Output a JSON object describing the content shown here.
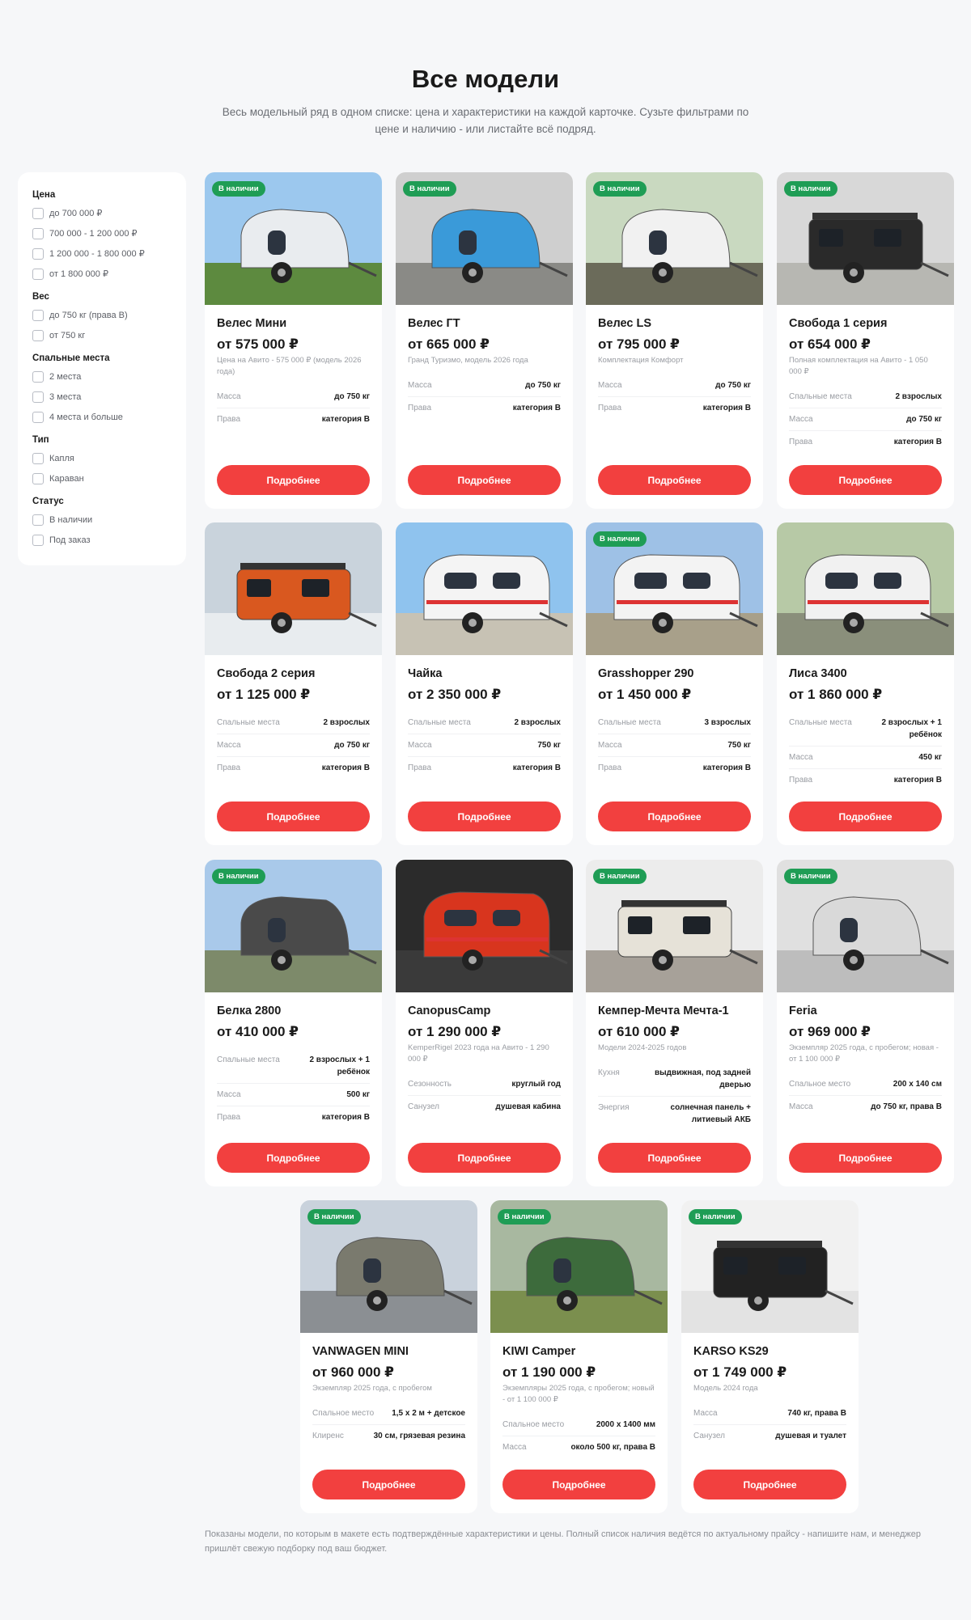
{
  "header": {
    "title": "Все модели",
    "subtitle": "Весь модельный ряд в одном списке: цена и характеристики на каждой карточке. Сузьте фильтрами по цене и наличию - или листайте всё подряд."
  },
  "filters": [
    {
      "title": "Цена",
      "options": [
        "до 700 000 ₽",
        "700 000 - 1 200 000 ₽",
        "1 200 000 - 1 800 000 ₽",
        "от 1 800 000 ₽"
      ]
    },
    {
      "title": "Вес",
      "options": [
        "до 750 кг (права B)",
        "от 750 кг"
      ]
    },
    {
      "title": "Спальные места",
      "options": [
        "2 места",
        "3 места",
        "4 места и больше"
      ]
    },
    {
      "title": "Тип",
      "options": [
        "Капля",
        "Караван"
      ]
    },
    {
      "title": "Статус",
      "options": [
        "В наличии",
        "Под заказ"
      ]
    }
  ],
  "badge_label": "В наличии",
  "button_label": "Подробнее",
  "cards": [
    {
      "title": "Велес Мини",
      "price": "от 575 000 ₽",
      "note": "Цена на Авито - 575 000 ₽ (модель 2026 года)",
      "badge": true,
      "specs": [
        [
          "Масса",
          "до 750 кг"
        ],
        [
          "Права",
          "категория B"
        ]
      ]
    },
    {
      "title": "Велес ГТ",
      "price": "от 665 000 ₽",
      "note": "Гранд Туризмо, модель 2026 года",
      "badge": true,
      "specs": [
        [
          "Масса",
          "до 750 кг"
        ],
        [
          "Права",
          "категория B"
        ]
      ]
    },
    {
      "title": "Велес LS",
      "price": "от 795 000 ₽",
      "note": "Комплектация Комфорт",
      "badge": true,
      "specs": [
        [
          "Масса",
          "до 750 кг"
        ],
        [
          "Права",
          "категория B"
        ]
      ]
    },
    {
      "title": "Свобода 1 серия",
      "price": "от 654 000 ₽",
      "note": "Полная комплектация на Авито - 1 050 000 ₽",
      "badge": true,
      "specs": [
        [
          "Спальные места",
          "2 взрослых"
        ],
        [
          "Масса",
          "до 750 кг"
        ],
        [
          "Права",
          "категория B"
        ]
      ]
    },
    {
      "title": "Свобода 2 серия",
      "price": "от 1 125 000 ₽",
      "note": "",
      "badge": false,
      "specs": [
        [
          "Спальные места",
          "2 взрослых"
        ],
        [
          "Масса",
          "до 750 кг"
        ],
        [
          "Права",
          "категория B"
        ]
      ]
    },
    {
      "title": "Чайка",
      "price": "от 2 350 000 ₽",
      "note": "",
      "badge": false,
      "specs": [
        [
          "Спальные места",
          "2 взрослых"
        ],
        [
          "Масса",
          "750 кг"
        ],
        [
          "Права",
          "категория B"
        ]
      ]
    },
    {
      "title": "Grasshopper 290",
      "price": "от 1 450 000 ₽",
      "note": "",
      "badge": true,
      "specs": [
        [
          "Спальные места",
          "3 взрослых"
        ],
        [
          "Масса",
          "750 кг"
        ],
        [
          "Права",
          "категория B"
        ]
      ]
    },
    {
      "title": "Лиса 3400",
      "price": "от 1 860 000 ₽",
      "note": "",
      "badge": false,
      "specs": [
        [
          "Спальные места",
          "2 взрослых + 1 ребёнок"
        ],
        [
          "Масса",
          "450 кг"
        ],
        [
          "Права",
          "категория B"
        ]
      ]
    },
    {
      "title": "Белка 2800",
      "price": "от 410 000 ₽",
      "note": "",
      "badge": true,
      "specs": [
        [
          "Спальные места",
          "2 взрослых + 1 ребёнок"
        ],
        [
          "Масса",
          "500 кг"
        ],
        [
          "Права",
          "категория B"
        ]
      ]
    },
    {
      "title": "CanopusCamp",
      "price": "от 1 290 000 ₽",
      "note": "KemperRigel 2023 года на Авито - 1 290 000 ₽",
      "badge": false,
      "specs": [
        [
          "Сезонность",
          "круглый год"
        ],
        [
          "Санузел",
          "душевая кабина"
        ]
      ]
    },
    {
      "title": "Кемпер-Мечта Мечта-1",
      "price": "от 610 000 ₽",
      "note": "Модели 2024-2025 годов",
      "badge": true,
      "specs": [
        [
          "Кухня",
          "выдвижная, под задней дверью"
        ],
        [
          "Энергия",
          "солнечная панель + литиевый АКБ"
        ]
      ]
    },
    {
      "title": "Feria",
      "price": "от 969 000 ₽",
      "note": "Экземпляр 2025 года, с пробегом; новая - от 1 100 000 ₽",
      "badge": true,
      "specs": [
        [
          "Спальное место",
          "200 х 140 см"
        ],
        [
          "Масса",
          "до 750 кг, права B"
        ]
      ]
    },
    {
      "title": "VANWAGEN MINI",
      "price": "от 960 000 ₽",
      "note": "Экземпляр 2025 года, с пробегом",
      "badge": true,
      "specs": [
        [
          "Спальное место",
          "1,5 х 2 м + детское"
        ],
        [
          "Клиренс",
          "30 см, грязевая резина"
        ]
      ]
    },
    {
      "title": "KIWI Camper",
      "price": "от 1 190 000 ₽",
      "note": "Экземпляры 2025 года, с пробегом; новый - от 1 100 000 ₽",
      "badge": true,
      "specs": [
        [
          "Спальное место",
          "2000 х 1400 мм"
        ],
        [
          "Масса",
          "около 500 кг, права B"
        ]
      ]
    },
    {
      "title": "KARSO KS29",
      "price": "от 1 749 000 ₽",
      "note": "Модель 2024 года",
      "badge": true,
      "specs": [
        [
          "Масса",
          "740 кг, права B"
        ],
        [
          "Санузел",
          "душевая и туалет"
        ]
      ]
    }
  ],
  "footer_note": "Показаны модели, по которым в макете есть подтверждённые характеристики и цены. Полный список наличия ведётся по актуальному прайсу - напишите нам, и менеджер пришлёт свежую подборку под ваш бюджет.",
  "colors": {
    "accent": "#f2403f",
    "badge": "#1f9d55",
    "background": "#f6f7f9"
  }
}
